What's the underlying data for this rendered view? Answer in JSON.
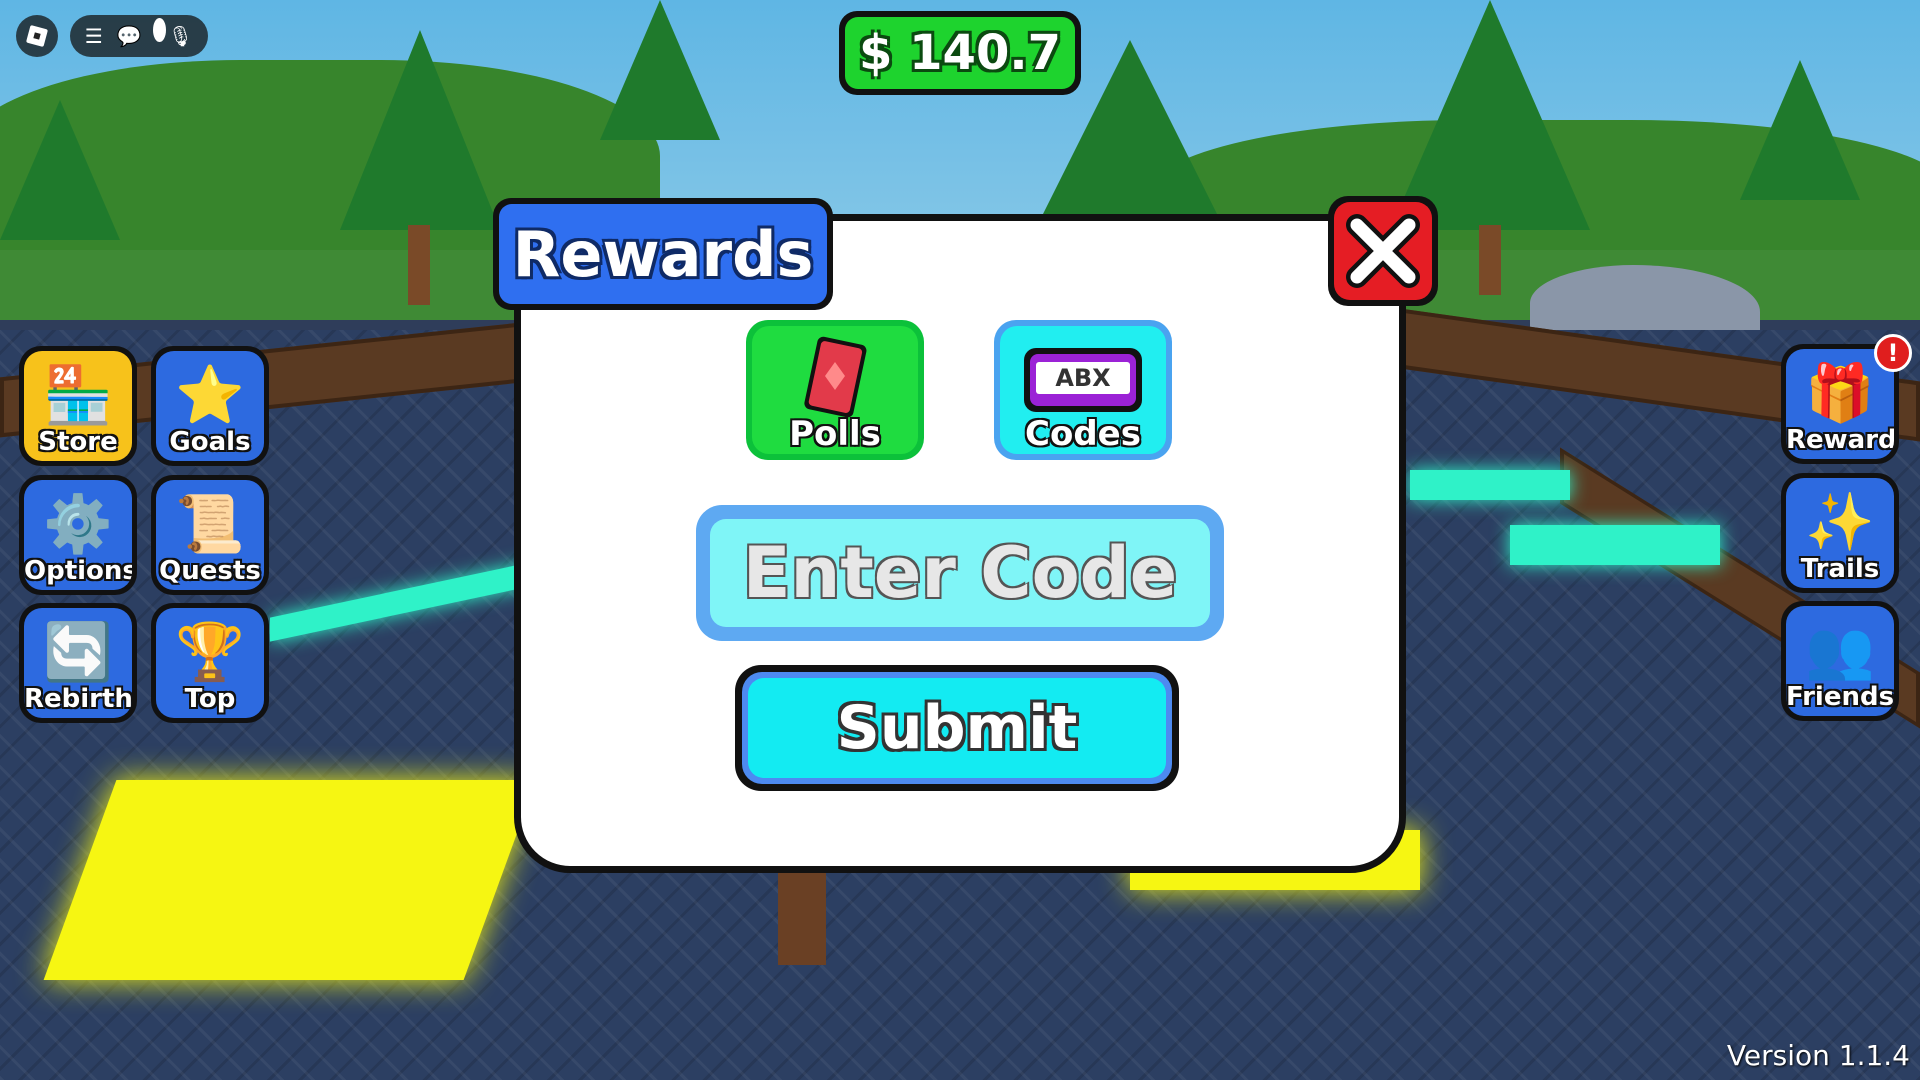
{
  "topbar": {
    "menu_icon": "hamburger-icon",
    "chat_icon": "chat-icon",
    "chat_badge": "2",
    "mic_icon": "microphone-muted-icon"
  },
  "currency": {
    "display": "$ 140.7"
  },
  "left_buttons": [
    {
      "label": "Store",
      "icon": "store-icon"
    },
    {
      "label": "Goals",
      "icon": "star-icon"
    },
    {
      "label": "Options",
      "icon": "gear-icon"
    },
    {
      "label": "Quests",
      "icon": "scroll-icon"
    },
    {
      "label": "Rebirth",
      "icon": "rebirth-icon"
    },
    {
      "label": "Top",
      "icon": "trophy-icon"
    }
  ],
  "right_buttons": [
    {
      "label": "Rewards",
      "icon": "gift-icon",
      "badge": "!"
    },
    {
      "label": "Trails",
      "icon": "sparkle-icon"
    },
    {
      "label": "Friends",
      "icon": "friends-icon"
    }
  ],
  "modal": {
    "title": "Rewards",
    "tabs": [
      {
        "label": "Polls",
        "icon": "book-icon"
      },
      {
        "label": "Codes",
        "icon": "abx-sign-icon",
        "icon_text": "ABX"
      }
    ],
    "code_placeholder": "Enter Code",
    "submit_label": "Submit"
  },
  "version": "Version 1.1.4",
  "colors": {
    "money_green": "#1ed32e",
    "title_blue": "#2f6ff0",
    "close_red": "#e51d24",
    "submit_cyan": "#13ebf2"
  }
}
